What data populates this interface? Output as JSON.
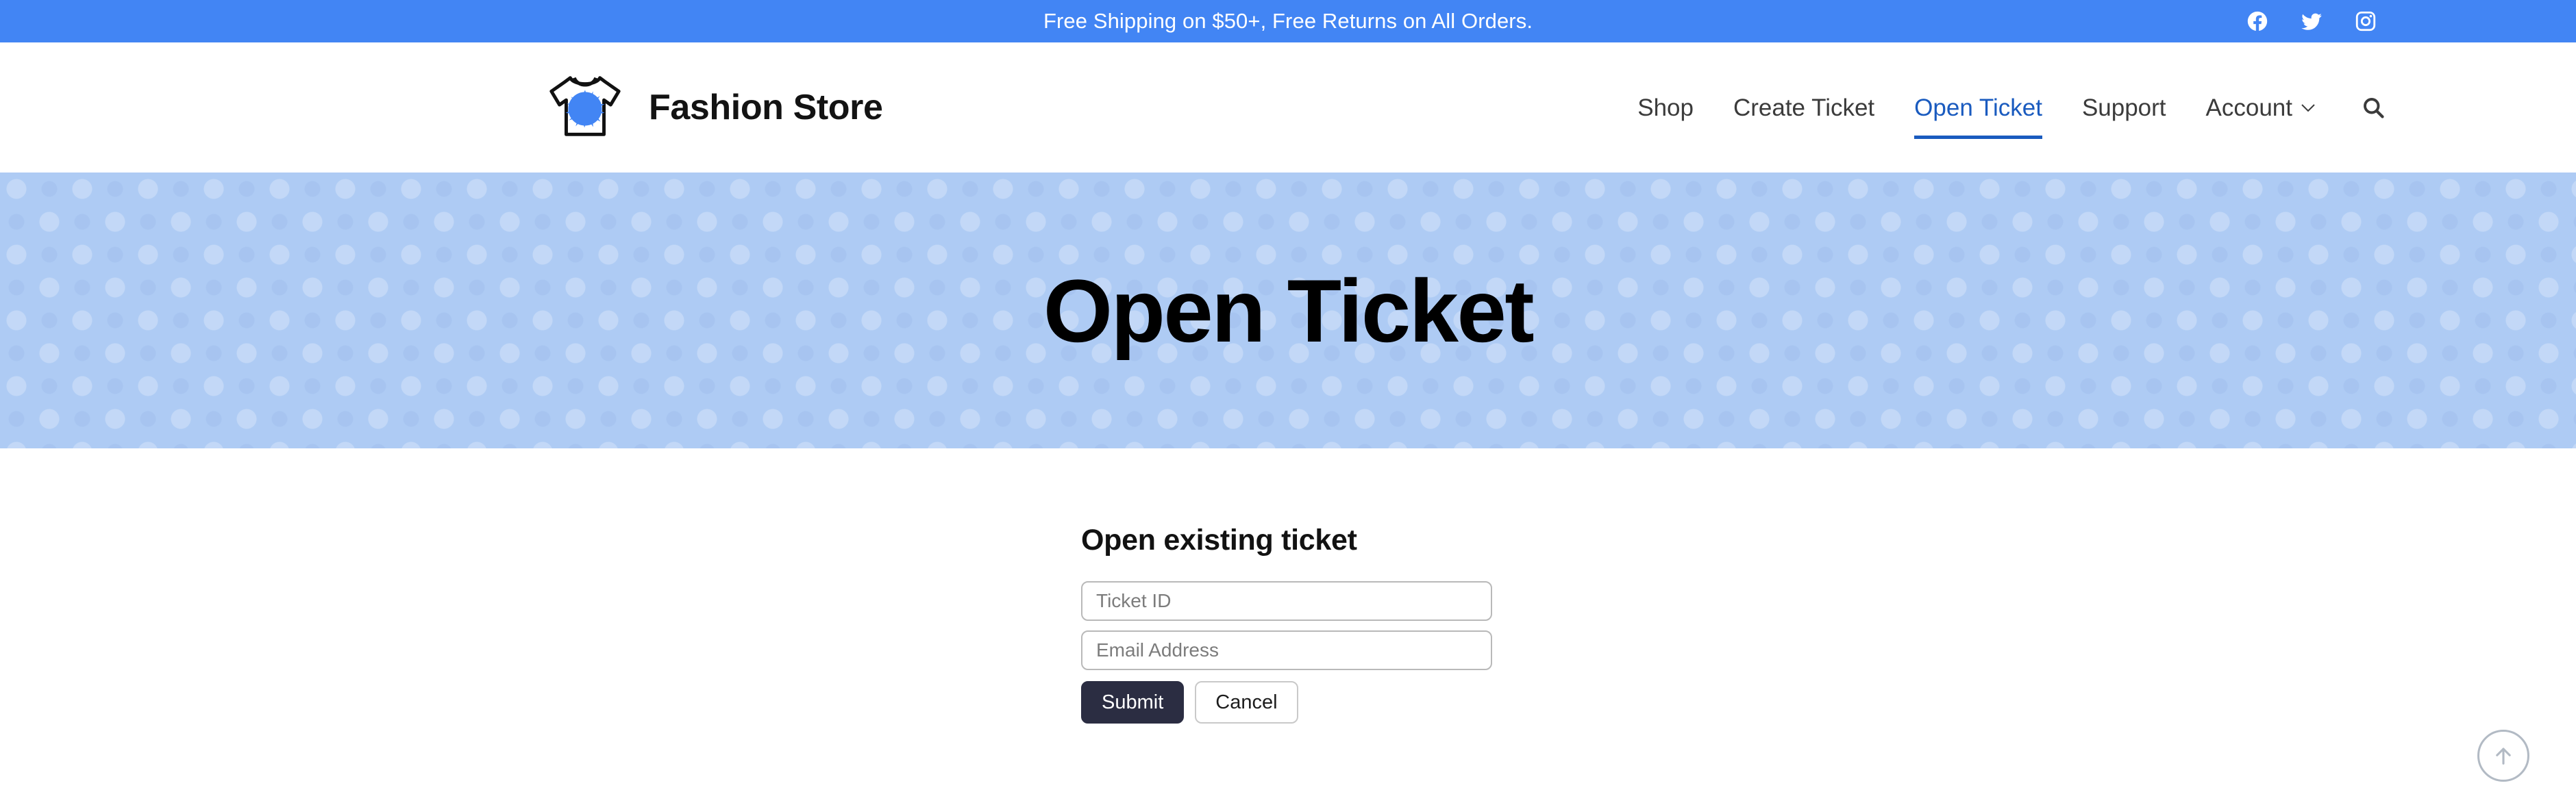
{
  "announcement": {
    "text": "Free Shipping on $50+, Free Returns on All Orders.",
    "background_color": "#4285f4",
    "social": [
      {
        "name": "facebook-icon",
        "label": "Facebook"
      },
      {
        "name": "twitter-icon",
        "label": "Twitter"
      },
      {
        "name": "instagram-icon",
        "label": "Instagram"
      }
    ]
  },
  "header": {
    "brand_name": "Fashion Store",
    "logo_icon": "tshirt-paint-splatter-logo",
    "search_icon": "search-icon",
    "nav": [
      {
        "label": "Shop",
        "active": false
      },
      {
        "label": "Create Ticket",
        "active": false
      },
      {
        "label": "Open Ticket",
        "active": true
      },
      {
        "label": "Support",
        "active": false
      },
      {
        "label": "Account",
        "active": false,
        "has_dropdown": true
      }
    ],
    "active_color": "#1a5bbf"
  },
  "hero": {
    "title": "Open Ticket",
    "background_color": "#aecbf4"
  },
  "form": {
    "heading": "Open existing ticket",
    "ticket_id": {
      "value": "",
      "placeholder": "Ticket ID"
    },
    "email": {
      "value": "",
      "placeholder": "Email Address"
    },
    "submit_label": "Submit",
    "cancel_label": "Cancel",
    "submit_color": "#2b2d42"
  },
  "scroll_top": {
    "icon": "arrow-up-icon"
  }
}
